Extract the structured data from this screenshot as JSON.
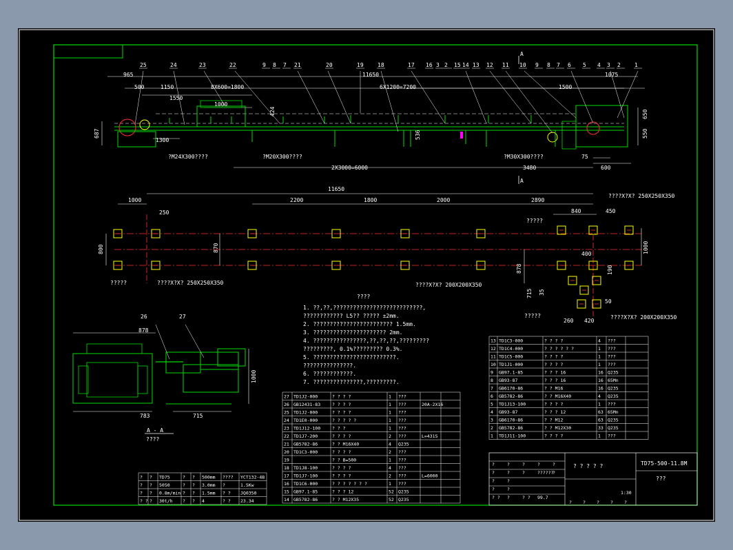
{
  "colors": {
    "background": "#8a99ab",
    "canvas": "#000000",
    "line": "#00dd00",
    "text": "#ffffff",
    "centerline": "#ff3030",
    "accent": "#ffff00",
    "magenta": "#ff00ff"
  },
  "drawing": {
    "title": "TD75-500-11.8M",
    "subtitle": "???",
    "name_cell": "? ? ? ? ?",
    "scale": "1:30",
    "section_label": "A - A",
    "section_sub": "????",
    "section_mark": "A"
  },
  "callouts": {
    "top_row": [
      "25",
      "24",
      "23",
      "22",
      "9",
      "8",
      "7",
      "21",
      "20",
      "19",
      "18",
      "17",
      "16",
      "3",
      "2",
      "15",
      "14",
      "13",
      "12",
      "11",
      "10",
      "9",
      "8",
      "7",
      "6",
      "5",
      "4",
      "3",
      "2",
      "1"
    ],
    "section": [
      "26",
      "27"
    ]
  },
  "dims_elevation": {
    "d965": "965",
    "d500": "500",
    "d1150": "1150",
    "d1550": "1550",
    "d8x600": "8X600=1800",
    "d1000": "1000",
    "d11650": "11650",
    "d6x1200": "6X1200=7200",
    "d1500": "1500",
    "d1075": "1075",
    "d687": "687",
    "d1300": "1300",
    "d650": "650",
    "d550": "550",
    "d536": "536",
    "d424": "424",
    "m24": "?M24X300????",
    "m20": "?M20X300????",
    "m30": "?M30X300????",
    "d2x3000": "2X3000=6000",
    "d3480": "3480",
    "d75": "75",
    "d600": "600"
  },
  "dims_plan": {
    "d11650": "11650",
    "d1000": "1000",
    "d250": "250",
    "d2200": "2200",
    "d1800": "1800",
    "d2000": "2000",
    "d2890": "2890",
    "d840": "840",
    "d450": "450",
    "d800": "800",
    "d870": "870",
    "d878": "878",
    "d1000b": "1000",
    "d400": "400",
    "d190": "190",
    "d715": "715",
    "d50": "50",
    "d35": "35",
    "d260": "260",
    "d420": "420",
    "hole1": "?????",
    "hole2": "????X?X?  250X250X350",
    "hole3": "????X?X?  200X200X350",
    "hole4": "?????",
    "hole5": "????X?X?  250X250X350",
    "hole6": "?????",
    "hole7": "????X?X?  200X200X350",
    "hole8": "?????"
  },
  "dims_section": {
    "d878": "878",
    "d783": "783",
    "d715": "715",
    "d1000": "1000"
  },
  "notes": {
    "heading": "????",
    "lines": [
      "1. ??,??,???????????????????????????,",
      "   ????????????      L5??       ?????        ±2mm.",
      "2. ????????????????????????          1.5mm.",
      "3. ??????????????????????           2mm.",
      "4. ????????????????,??,??,??,?????????",
      "   ?????????,   0.1%?????????         0.3%.",
      "5. ?????????????????????????.",
      "   ???????????????.",
      "6. ????????????.",
      "7. ???????????????,?????????."
    ]
  },
  "bom_right": [
    {
      "no": "13",
      "code": "TD1C3-000",
      "name": "? ? ? ?",
      "qty": "4",
      "mat": "???"
    },
    {
      "no": "12",
      "code": "TD1C4-000",
      "name": "? ? ? ? ? ?",
      "qty": "1",
      "mat": "???"
    },
    {
      "no": "11",
      "code": "TD1C5-000",
      "name": "? ? ? ?",
      "qty": "1",
      "mat": "???"
    },
    {
      "no": "10",
      "code": "TD1J1-000",
      "name": "? ? ? ?",
      "qty": "1",
      "mat": "???"
    },
    {
      "no": "9",
      "code": "GB97.1-85",
      "name": "? ? ?    16",
      "qty": "16",
      "mat": "Q235"
    },
    {
      "no": "8",
      "code": "GB93-87",
      "name": "? ? ?    16",
      "qty": "16",
      "mat": "65Mn"
    },
    {
      "no": "7",
      "code": "GB6170-86",
      "name": "? ?    M16",
      "qty": "16",
      "mat": "Q235"
    },
    {
      "no": "6",
      "code": "GB5782-86",
      "name": "? ?   M16X40",
      "qty": "4",
      "mat": "Q235"
    },
    {
      "no": "5",
      "code": "TD1J13-100",
      "name": "? ? ? ?",
      "qty": "1",
      "mat": "???"
    },
    {
      "no": "4",
      "code": "GB93-87",
      "name": "? ? ?    12",
      "qty": "63",
      "mat": "65Mn"
    },
    {
      "no": "3",
      "code": "GB6170-86",
      "name": "? ?    M12",
      "qty": "63",
      "mat": "Q235"
    },
    {
      "no": "2",
      "code": "GB5782-86",
      "name": "? ?   M12X30",
      "qty": "33",
      "mat": "Q235"
    },
    {
      "no": "1",
      "code": "TD1J11-100",
      "name": "? ? ? ?",
      "qty": "1",
      "mat": "???"
    }
  ],
  "bom_mid": [
    {
      "no": "27",
      "code": "TD1J2-000",
      "name": "? ? ? ?",
      "qty": "1",
      "mat": "???",
      "note": ""
    },
    {
      "no": "26",
      "code": "GB12431-83",
      "name": "? ? ? ?",
      "qty": "1",
      "mat": "???",
      "note": "20A-2X16"
    },
    {
      "no": "25",
      "code": "TD1J2-000",
      "name": "? ? ? ?",
      "qty": "1",
      "mat": "???",
      "note": ""
    },
    {
      "no": "24",
      "code": "TD1E0-000",
      "name": "? ? ? ? ?",
      "qty": "1",
      "mat": "???",
      "note": ""
    },
    {
      "no": "23",
      "code": "TD1J12-100",
      "name": "? ? ?",
      "qty": "1",
      "mat": "???",
      "note": ""
    },
    {
      "no": "22",
      "code": "TD1J7-200",
      "name": "? ? ? ?",
      "qty": "2",
      "mat": "???",
      "note": "L=4315"
    },
    {
      "no": "21",
      "code": "GB5782-86",
      "name": "? ?      M16X40",
      "qty": "4",
      "mat": "Q235",
      "note": ""
    },
    {
      "no": "20",
      "code": "TD1C3-000",
      "name": "? ? ? ?",
      "qty": "2",
      "mat": "???",
      "note": ""
    },
    {
      "no": "19",
      "code": "",
      "name": "? ?    B=500",
      "qty": "1",
      "mat": "???",
      "note": ""
    },
    {
      "no": "18",
      "code": "TD1J8-100",
      "name": "? ? ? ?",
      "qty": "4",
      "mat": "???",
      "note": ""
    },
    {
      "no": "17",
      "code": "TD1J7-100",
      "name": "? ? ? ?",
      "qty": "2",
      "mat": "???",
      "note": "L=6000"
    },
    {
      "no": "16",
      "code": "TD1C6-000",
      "name": "? ? ? ? ? ? ?",
      "qty": "1",
      "mat": "???",
      "note": ""
    },
    {
      "no": "15",
      "code": "GB97.1-85",
      "name": "? ? ?     12",
      "qty": "52",
      "mat": "Q235",
      "note": ""
    },
    {
      "no": "14",
      "code": "GB5782-86",
      "name": "? ?      M12X35",
      "qty": "52",
      "mat": "Q235",
      "note": ""
    }
  ],
  "specs": [
    [
      "?",
      "?",
      "TD75",
      "?",
      "?",
      "500mm",
      "????",
      "YCT132-4B"
    ],
    [
      "?",
      "?",
      "5050",
      "?",
      "?",
      "3.0mm",
      "?",
      "1.5Kw"
    ],
    [
      "?",
      "?",
      "0.8m/min",
      "?",
      "?",
      "1.5mm",
      "? ?",
      "JQ0350"
    ],
    [
      "? ?",
      "?",
      "30t/h",
      "?",
      "?",
      "4",
      "? ?",
      "23.34"
    ]
  ],
  "title_block": {
    "rows_left": [
      [
        "?",
        "?",
        "?",
        "?",
        "?"
      ],
      [
        "?",
        "?",
        "?",
        "??????",
        "?"
      ],
      [
        "?",
        "?",
        "",
        ""
      ],
      [
        "?",
        "?",
        "",
        ""
      ],
      [
        "? ?",
        "?",
        "? ?",
        "99.7"
      ]
    ],
    "bottom": [
      "?",
      "?",
      "?",
      "?",
      "?"
    ]
  }
}
